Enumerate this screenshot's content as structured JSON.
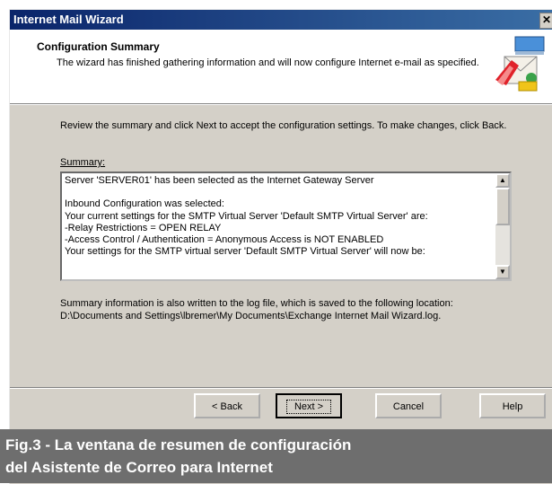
{
  "window": {
    "title": "Internet Mail Wizard",
    "close_label": "✕"
  },
  "header": {
    "title": "Configuration Summary",
    "subtitle": "The wizard has finished gathering information and will now configure Internet e-mail as specified.",
    "icon": "mail-wizard-icon"
  },
  "intro": "Review the summary and click Next to accept the configuration settings. To make changes, click Back.",
  "summary": {
    "label": "Summary:",
    "lines": [
      "Server 'SERVER01' has been selected as the Internet Gateway Server",
      "",
      "Inbound Configuration was selected:",
      "Your current settings for the SMTP Virtual Server 'Default SMTP Virtual Server' are:",
      "-Relay Restrictions = OPEN RELAY",
      "-Access Control / Authentication = Anonymous Access is NOT ENABLED",
      "Your settings for the SMTP virtual server 'Default SMTP Virtual Server' will now be:"
    ]
  },
  "footer_text": "Summary information is also written to the log file, which is saved to the following location: D:\\Documents and Settings\\lbremer\\My Documents\\Exchange Internet Mail Wizard.log.",
  "buttons": {
    "back": "< Back",
    "next": "Next >",
    "cancel": "Cancel",
    "help": "Help"
  },
  "caption": {
    "line1": "Fig.3 - La ventana de resumen de configuración",
    "line2": "del Asistente de Correo para Internet"
  }
}
